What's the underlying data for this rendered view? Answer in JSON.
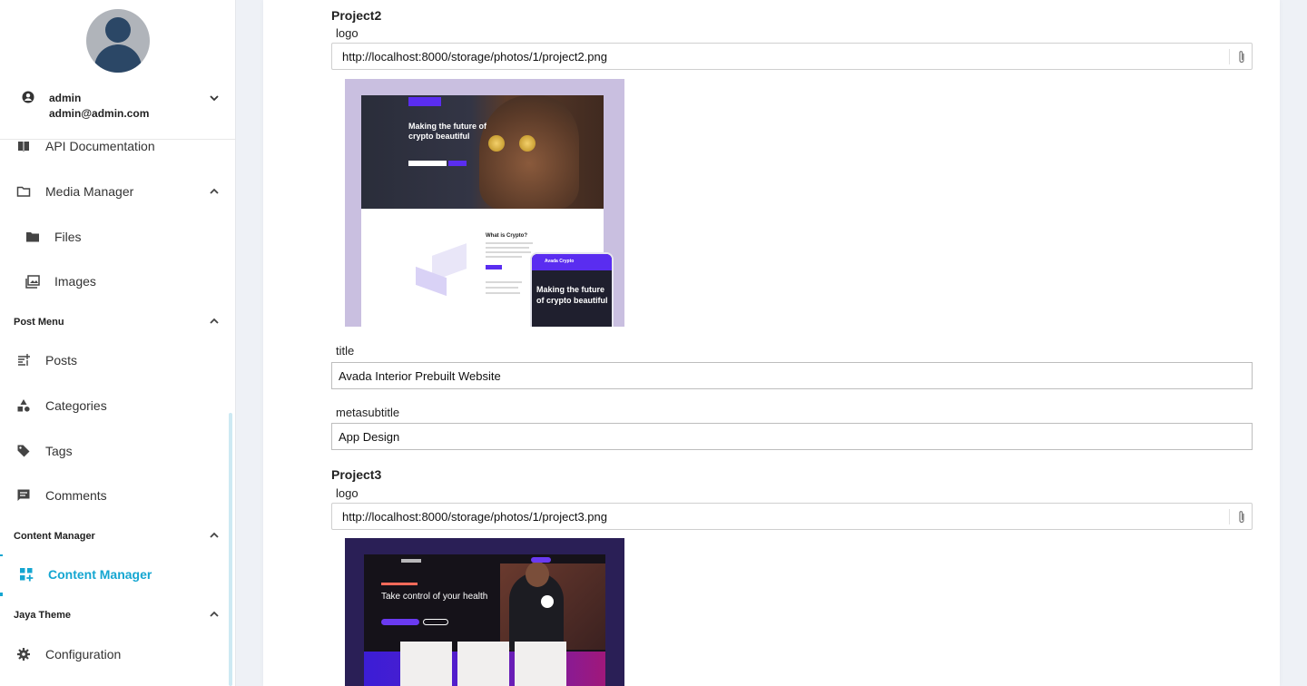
{
  "user": {
    "name": "admin",
    "email": "admin@admin.com"
  },
  "sidebar": {
    "items": [
      {
        "label": "API Documentation",
        "icon": "book-icon"
      },
      {
        "label": "Media Manager",
        "icon": "folder-icon"
      },
      {
        "label": "Files",
        "icon": "folder-filled-icon"
      },
      {
        "label": "Images",
        "icon": "images-icon"
      },
      {
        "label": "Posts",
        "icon": "post-add-icon"
      },
      {
        "label": "Categories",
        "icon": "category-icon"
      },
      {
        "label": "Tags",
        "icon": "tag-icon"
      },
      {
        "label": "Comments",
        "icon": "comment-icon"
      },
      {
        "label": "Content Manager",
        "icon": "dashboard-add-icon"
      },
      {
        "label": "Configuration",
        "icon": "gear-icon"
      }
    ],
    "sections": {
      "post_menu": "Post Menu",
      "content_manager": "Content Manager",
      "jaya_theme": "Jaya Theme"
    },
    "accent_color": "#15a6d1"
  },
  "main": {
    "project2": {
      "heading": "Project2",
      "logo_label": "logo",
      "logo_url": "http://localhost:8000/storage/photos/1/project2.png",
      "thumb": {
        "hero_text": "Making the future of crypto beautiful",
        "section_title": "What is Crypto?",
        "phone_brand": "Avada Crypto",
        "phone_text": "Making the future of crypto beautiful"
      },
      "title_label": "title",
      "title_value": "Avada Interior Prebuilt Website",
      "metasubtitle_label": "metasubtitle",
      "metasubtitle_value": "App Design"
    },
    "project3": {
      "heading": "Project3",
      "logo_label": "logo",
      "logo_url": "http://localhost:8000/storage/photos/1/project3.png",
      "thumb": {
        "headline": "Take control of your health"
      }
    }
  }
}
